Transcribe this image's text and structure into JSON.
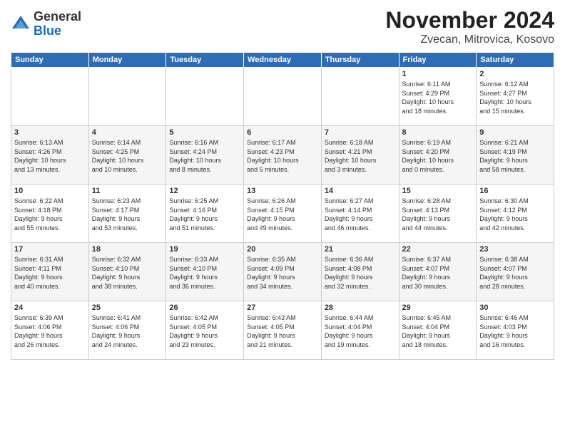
{
  "header": {
    "logo_general": "General",
    "logo_blue": "Blue",
    "month_title": "November 2024",
    "location": "Zvecan, Mitrovica, Kosovo"
  },
  "weekdays": [
    "Sunday",
    "Monday",
    "Tuesday",
    "Wednesday",
    "Thursday",
    "Friday",
    "Saturday"
  ],
  "weeks": [
    [
      {
        "day": "",
        "info": ""
      },
      {
        "day": "",
        "info": ""
      },
      {
        "day": "",
        "info": ""
      },
      {
        "day": "",
        "info": ""
      },
      {
        "day": "",
        "info": ""
      },
      {
        "day": "1",
        "info": "Sunrise: 6:11 AM\nSunset: 4:29 PM\nDaylight: 10 hours\nand 18 minutes."
      },
      {
        "day": "2",
        "info": "Sunrise: 6:12 AM\nSunset: 4:27 PM\nDaylight: 10 hours\nand 15 minutes."
      }
    ],
    [
      {
        "day": "3",
        "info": "Sunrise: 6:13 AM\nSunset: 4:26 PM\nDaylight: 10 hours\nand 13 minutes."
      },
      {
        "day": "4",
        "info": "Sunrise: 6:14 AM\nSunset: 4:25 PM\nDaylight: 10 hours\nand 10 minutes."
      },
      {
        "day": "5",
        "info": "Sunrise: 6:16 AM\nSunset: 4:24 PM\nDaylight: 10 hours\nand 8 minutes."
      },
      {
        "day": "6",
        "info": "Sunrise: 6:17 AM\nSunset: 4:23 PM\nDaylight: 10 hours\nand 5 minutes."
      },
      {
        "day": "7",
        "info": "Sunrise: 6:18 AM\nSunset: 4:21 PM\nDaylight: 10 hours\nand 3 minutes."
      },
      {
        "day": "8",
        "info": "Sunrise: 6:19 AM\nSunset: 4:20 PM\nDaylight: 10 hours\nand 0 minutes."
      },
      {
        "day": "9",
        "info": "Sunrise: 6:21 AM\nSunset: 4:19 PM\nDaylight: 9 hours\nand 58 minutes."
      }
    ],
    [
      {
        "day": "10",
        "info": "Sunrise: 6:22 AM\nSunset: 4:18 PM\nDaylight: 9 hours\nand 55 minutes."
      },
      {
        "day": "11",
        "info": "Sunrise: 6:23 AM\nSunset: 4:17 PM\nDaylight: 9 hours\nand 53 minutes."
      },
      {
        "day": "12",
        "info": "Sunrise: 6:25 AM\nSunset: 4:16 PM\nDaylight: 9 hours\nand 51 minutes."
      },
      {
        "day": "13",
        "info": "Sunrise: 6:26 AM\nSunset: 4:15 PM\nDaylight: 9 hours\nand 49 minutes."
      },
      {
        "day": "14",
        "info": "Sunrise: 6:27 AM\nSunset: 4:14 PM\nDaylight: 9 hours\nand 46 minutes."
      },
      {
        "day": "15",
        "info": "Sunrise: 6:28 AM\nSunset: 4:13 PM\nDaylight: 9 hours\nand 44 minutes."
      },
      {
        "day": "16",
        "info": "Sunrise: 6:30 AM\nSunset: 4:12 PM\nDaylight: 9 hours\nand 42 minutes."
      }
    ],
    [
      {
        "day": "17",
        "info": "Sunrise: 6:31 AM\nSunset: 4:11 PM\nDaylight: 9 hours\nand 40 minutes."
      },
      {
        "day": "18",
        "info": "Sunrise: 6:32 AM\nSunset: 4:10 PM\nDaylight: 9 hours\nand 38 minutes."
      },
      {
        "day": "19",
        "info": "Sunrise: 6:33 AM\nSunset: 4:10 PM\nDaylight: 9 hours\nand 36 minutes."
      },
      {
        "day": "20",
        "info": "Sunrise: 6:35 AM\nSunset: 4:09 PM\nDaylight: 9 hours\nand 34 minutes."
      },
      {
        "day": "21",
        "info": "Sunrise: 6:36 AM\nSunset: 4:08 PM\nDaylight: 9 hours\nand 32 minutes."
      },
      {
        "day": "22",
        "info": "Sunrise: 6:37 AM\nSunset: 4:07 PM\nDaylight: 9 hours\nand 30 minutes."
      },
      {
        "day": "23",
        "info": "Sunrise: 6:38 AM\nSunset: 4:07 PM\nDaylight: 9 hours\nand 28 minutes."
      }
    ],
    [
      {
        "day": "24",
        "info": "Sunrise: 6:39 AM\nSunset: 4:06 PM\nDaylight: 9 hours\nand 26 minutes."
      },
      {
        "day": "25",
        "info": "Sunrise: 6:41 AM\nSunset: 4:06 PM\nDaylight: 9 hours\nand 24 minutes."
      },
      {
        "day": "26",
        "info": "Sunrise: 6:42 AM\nSunset: 4:05 PM\nDaylight: 9 hours\nand 23 minutes."
      },
      {
        "day": "27",
        "info": "Sunrise: 6:43 AM\nSunset: 4:05 PM\nDaylight: 9 hours\nand 21 minutes."
      },
      {
        "day": "28",
        "info": "Sunrise: 6:44 AM\nSunset: 4:04 PM\nDaylight: 9 hours\nand 19 minutes."
      },
      {
        "day": "29",
        "info": "Sunrise: 6:45 AM\nSunset: 4:04 PM\nDaylight: 9 hours\nand 18 minutes."
      },
      {
        "day": "30",
        "info": "Sunrise: 6:46 AM\nSunset: 4:03 PM\nDaylight: 9 hours\nand 16 minutes."
      }
    ]
  ]
}
